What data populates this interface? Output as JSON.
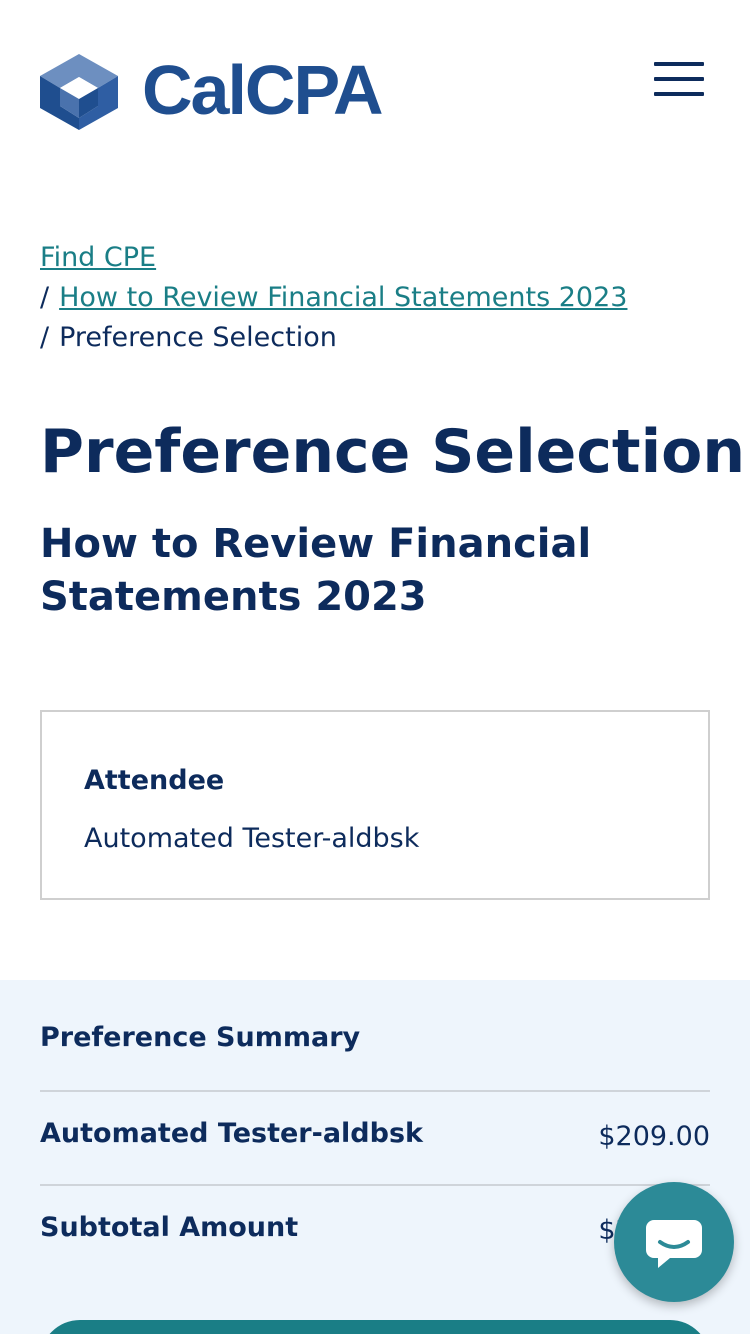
{
  "header": {
    "logo_text": "CalCPA",
    "brand_color": "#1f4e8f"
  },
  "breadcrumb": {
    "items": [
      {
        "label": "Find CPE"
      },
      {
        "label": "How to Review Financial Statements 2023"
      },
      {
        "label": "Preference Selection"
      }
    ],
    "separator": "/"
  },
  "main": {
    "title": "Preference Selection",
    "subtitle": "How to Review Financial Statements 2023"
  },
  "attendee": {
    "label": "Attendee",
    "name": "Automated Tester-aldbsk"
  },
  "summary": {
    "title": "Preference Summary",
    "rows": [
      {
        "label": "Automated Tester-aldbsk",
        "value": "$209.00"
      },
      {
        "label": "Subtotal Amount",
        "value": "$209.00"
      }
    ]
  },
  "colors": {
    "primary": "#0d2b5c",
    "link": "#1a7e86",
    "summary_bg": "#eef5fc",
    "chat": "#2c8a97"
  },
  "icons": {
    "menu": "hamburger-icon",
    "chat": "chat-bubble-icon",
    "logo": "cube-logo-icon"
  }
}
